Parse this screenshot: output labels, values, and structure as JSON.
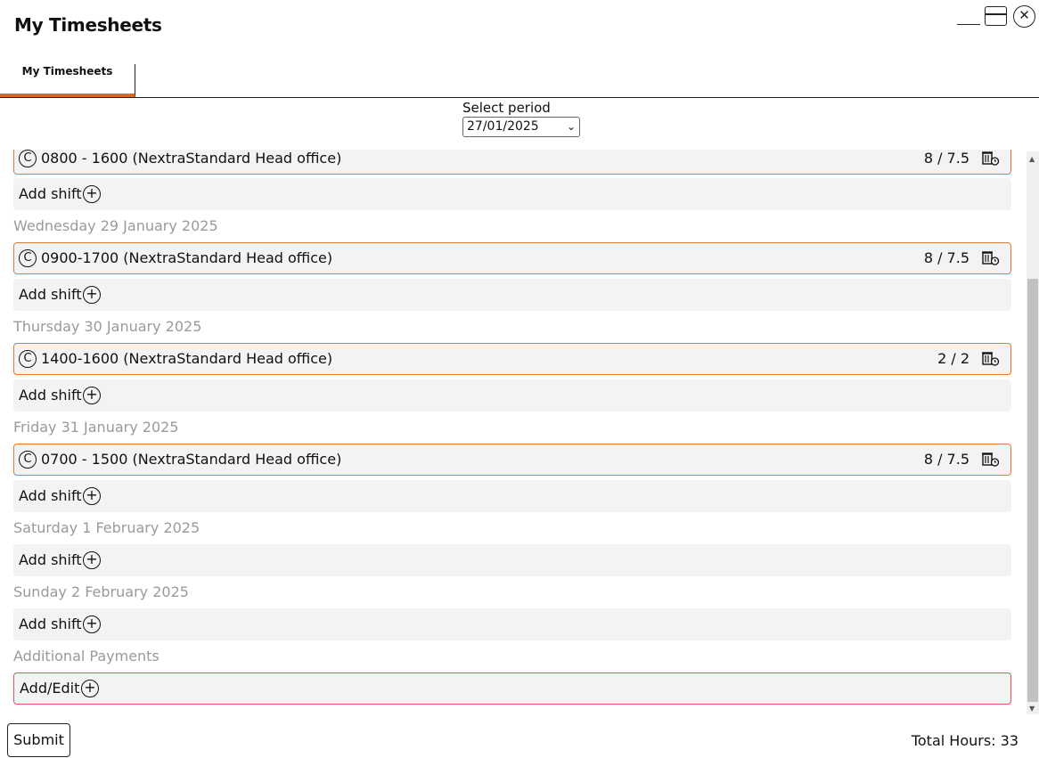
{
  "window": {
    "title": "My Timesheets"
  },
  "tabs": [
    {
      "label": "My Timesheets"
    }
  ],
  "period": {
    "label": "Select period",
    "selected": "27/01/2025"
  },
  "entries": [
    {
      "kind": "shift",
      "text": "0800 - 1600 (NextraStandard Head office)",
      "hours": "8 / 7.5"
    },
    {
      "kind": "add",
      "label": "Add shift"
    },
    {
      "kind": "day",
      "label": "Wednesday 29 January 2025"
    },
    {
      "kind": "shift",
      "text": "0900-1700 (NextraStandard Head office)",
      "hours": "8 / 7.5"
    },
    {
      "kind": "add",
      "label": "Add shift"
    },
    {
      "kind": "day",
      "label": "Thursday 30 January 2025"
    },
    {
      "kind": "shift",
      "text": "1400-1600 (NextraStandard Head office)",
      "hours": "2 / 2"
    },
    {
      "kind": "add",
      "label": "Add shift"
    },
    {
      "kind": "day",
      "label": "Friday 31 January 2025"
    },
    {
      "kind": "shift",
      "text": "0700 - 1500 (NextraStandard Head office)",
      "hours": "8 / 7.5"
    },
    {
      "kind": "add",
      "label": "Add shift"
    },
    {
      "kind": "day",
      "label": "Saturday 1 February 2025"
    },
    {
      "kind": "add",
      "label": "Add shift"
    },
    {
      "kind": "day",
      "label": "Sunday 2 February 2025"
    },
    {
      "kind": "add",
      "label": "Add shift"
    },
    {
      "kind": "day",
      "label": "Additional Payments"
    },
    {
      "kind": "payments",
      "label": "Add/Edit"
    }
  ],
  "footer": {
    "submit_label": "Submit",
    "total_label": "Total Hours: 33"
  },
  "colors": {
    "accent": "#d9691c",
    "shift_border": "#e07b39",
    "payments_border": "#e0525c",
    "day_label": "#9a9a9a"
  }
}
